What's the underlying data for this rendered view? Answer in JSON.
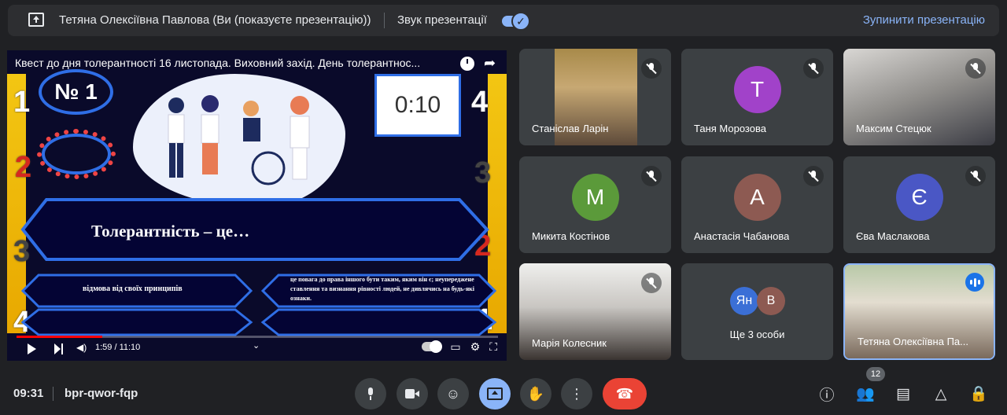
{
  "banner": {
    "presenter_text": "Тетяна Олексіївна Павлова (Ви (показуєте презентацію))",
    "audio_label": "Звук презентації",
    "audio_enabled": true,
    "stop_label": "Зупинити презентацію"
  },
  "presentation": {
    "video_title": "Квест до дня толерантності 16 листопада. Виховний захід. День толерантнос...",
    "slide_number": "№ 1",
    "timer": "0:10",
    "question": "Толерантність – це…",
    "answer_a": "відмова від своїх принципів",
    "answer_b": "це повага до права іншого бути таким, яким він є; неупереджене ставлення та визнання рівності людей, не дивлячись на будь-які ознаки.",
    "side_numbers_left": [
      "1",
      "2",
      "3",
      "4"
    ],
    "side_numbers_right": [
      "4",
      "3",
      "2",
      "1"
    ],
    "time_display": "1:59 / 11:10",
    "progress": 0.178
  },
  "participants": [
    {
      "name": "Станіслав Ларін",
      "type": "video",
      "muted": true
    },
    {
      "name": "Таня Морозова",
      "type": "avatar",
      "initial": "Т",
      "color": "#a142c9",
      "muted": true
    },
    {
      "name": "Максим Стецюк",
      "type": "video",
      "muted": true
    },
    {
      "name": "Микита Костінов",
      "type": "avatar",
      "initial": "М",
      "color": "#5b9a3a",
      "muted": true
    },
    {
      "name": "Анастасія Чабанова",
      "type": "avatar",
      "initial": "А",
      "color": "#8d5a52",
      "muted": true
    },
    {
      "name": "Єва Маслакова",
      "type": "avatar",
      "initial": "Є",
      "color": "#4a57c5",
      "muted": true
    },
    {
      "name": "Марія Колесник",
      "type": "video",
      "muted": true
    },
    {
      "name": "Тетяна Олексіївна Па...",
      "type": "video",
      "speaking": true
    }
  ],
  "more_people": {
    "initials": [
      "Ян",
      "В"
    ],
    "colors": [
      "#3b6fd6",
      "#8d5a52"
    ],
    "label": "Ще 3 особи"
  },
  "bottom": {
    "clock": "09:31",
    "meeting_code": "bpr-qwor-fqp",
    "participants_count": "12"
  },
  "icons": {
    "mic": "mic-icon",
    "camera": "camera-icon",
    "emoji": "emoji-icon",
    "present": "present-icon",
    "hand": "raise-hand-icon",
    "more": "more-options-icon",
    "hangup": "hangup-icon",
    "info": "info-icon",
    "people": "people-icon",
    "chat": "chat-icon",
    "activities": "activities-icon",
    "lock": "host-controls-icon"
  }
}
